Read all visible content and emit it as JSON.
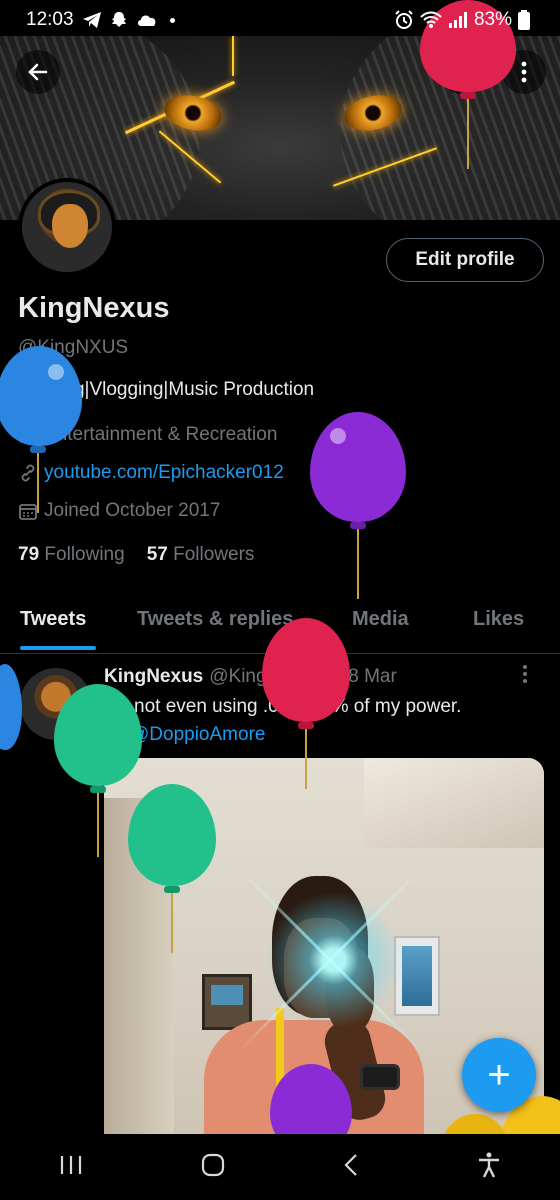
{
  "status_bar": {
    "time": "12:03",
    "battery": "83%"
  },
  "profile": {
    "edit_label": "Edit profile",
    "display_name": "KingNexus",
    "handle": "@KingNXUS",
    "bio": "Gaming|Vlogging|Music Production",
    "category": "Entertainment & Recreation",
    "link": "youtube.com/Epichacker012",
    "joined": "Joined October 2017",
    "following_count": "79",
    "following_label": "Following",
    "followers_count": "57",
    "followers_label": "Followers"
  },
  "tabs": [
    {
      "label": "Tweets"
    },
    {
      "label": "Tweets & replies"
    },
    {
      "label": "Media"
    },
    {
      "label": "Likes"
    }
  ],
  "tweet": {
    "author": "KingNexus",
    "handle": "@KingNXUS",
    "separator": "·",
    "date": "18 Mar",
    "text": "I'm not even using .000001% of my power.",
    "tag": "@DoppioAmore"
  },
  "fab": {
    "label": "+"
  },
  "colors": {
    "accent": "#1d9bf0",
    "background": "#000000",
    "muted": "#71767b",
    "text": "#e7e9ea"
  },
  "icons": {
    "back": "arrow-left-icon",
    "search": "search-icon",
    "more": "more-vertical-icon",
    "category": "briefcase-icon",
    "link": "link-icon",
    "joined": "calendar-icon",
    "photo_tag": "camera-icon",
    "nav_recents": "recents-icon",
    "nav_home": "home-icon",
    "nav_back": "nav-back-icon",
    "nav_accessibility": "accessibility-icon"
  }
}
